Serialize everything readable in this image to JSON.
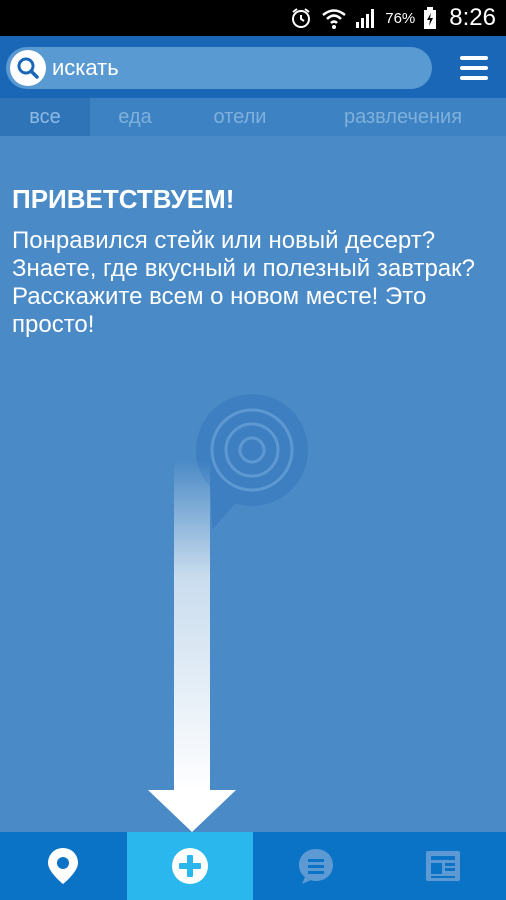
{
  "status_bar": {
    "battery_percent": "76%",
    "time": "8:26"
  },
  "search": {
    "placeholder": "искать"
  },
  "tabs": [
    {
      "label": "все"
    },
    {
      "label": "еда"
    },
    {
      "label": "отели"
    },
    {
      "label": "развлечения"
    }
  ],
  "welcome": {
    "title": "ПРИВЕТСТВУЕМ!",
    "text": "Понравился стейк или новый десерт? Знаете, где вкусный и полезный завтрак? Расскажите всем о новом месте! Это просто!"
  },
  "bottom_nav": [
    {
      "icon": "location-pin-icon"
    },
    {
      "icon": "add-icon"
    },
    {
      "icon": "chat-icon"
    },
    {
      "icon": "news-icon"
    }
  ],
  "colors": {
    "background": "#4a8ac6",
    "appbar": "#1b67b7",
    "bottom_bar": "#0b73c6",
    "bottom_active": "#29b7ee"
  }
}
